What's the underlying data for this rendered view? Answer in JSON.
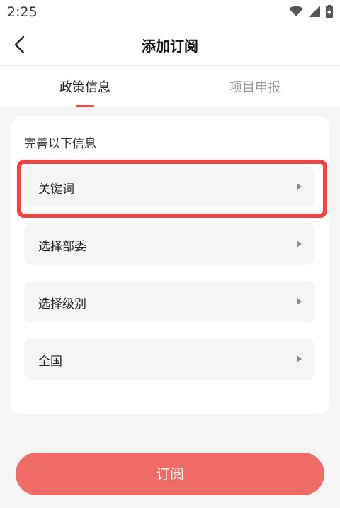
{
  "status_bar": {
    "time": "2:25"
  },
  "nav": {
    "title": "添加订阅"
  },
  "tabs": [
    {
      "label": "政策信息",
      "active": true
    },
    {
      "label": "项目申报",
      "active": false
    }
  ],
  "form": {
    "heading": "完善以下信息",
    "options": [
      {
        "label": "关键词"
      },
      {
        "label": "选择部委"
      },
      {
        "label": "选择级别"
      },
      {
        "label": "全国"
      }
    ]
  },
  "submit": {
    "label": "订阅"
  },
  "colors": {
    "accent": "#e74c4c",
    "button": "#f16b67",
    "highlight": "#ee4444"
  }
}
